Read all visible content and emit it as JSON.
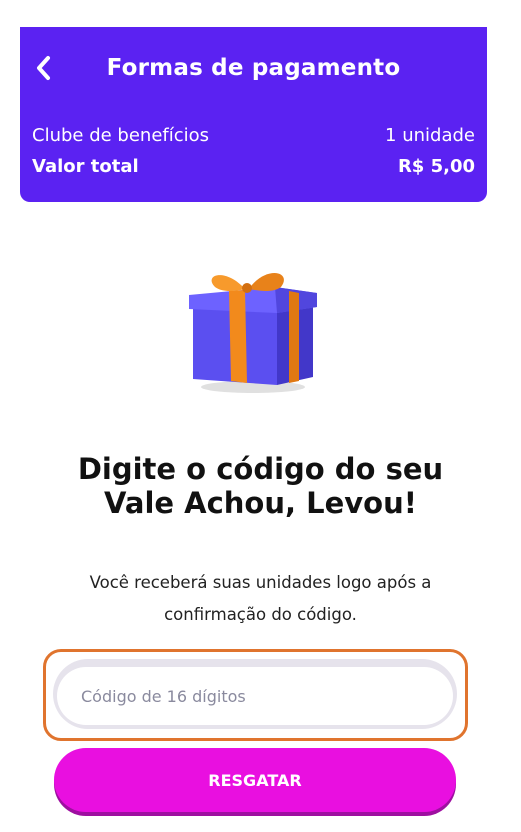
{
  "header": {
    "title": "Formas de pagamento",
    "rows": [
      {
        "label": "Clube de benefícios",
        "value": "1 unidade"
      },
      {
        "label": "Valor total",
        "value": "R$ 5,00"
      }
    ]
  },
  "content": {
    "headline_line1": "Digite o código do seu",
    "headline_line2": "Vale Achou, Levou!",
    "subtitle_line1": "Você receberá suas unidades logo após a",
    "subtitle_line2": "confirmação do código."
  },
  "form": {
    "code_placeholder": "Código de 16 dígitos",
    "code_value": "",
    "redeem_label": "RESGATAR"
  },
  "colors": {
    "header": "#5b22f2",
    "button": "#e90fe0",
    "highlight": "#e0742e"
  },
  "icons": {
    "back": "chevron-left-icon",
    "gift": "gift-box-icon"
  }
}
